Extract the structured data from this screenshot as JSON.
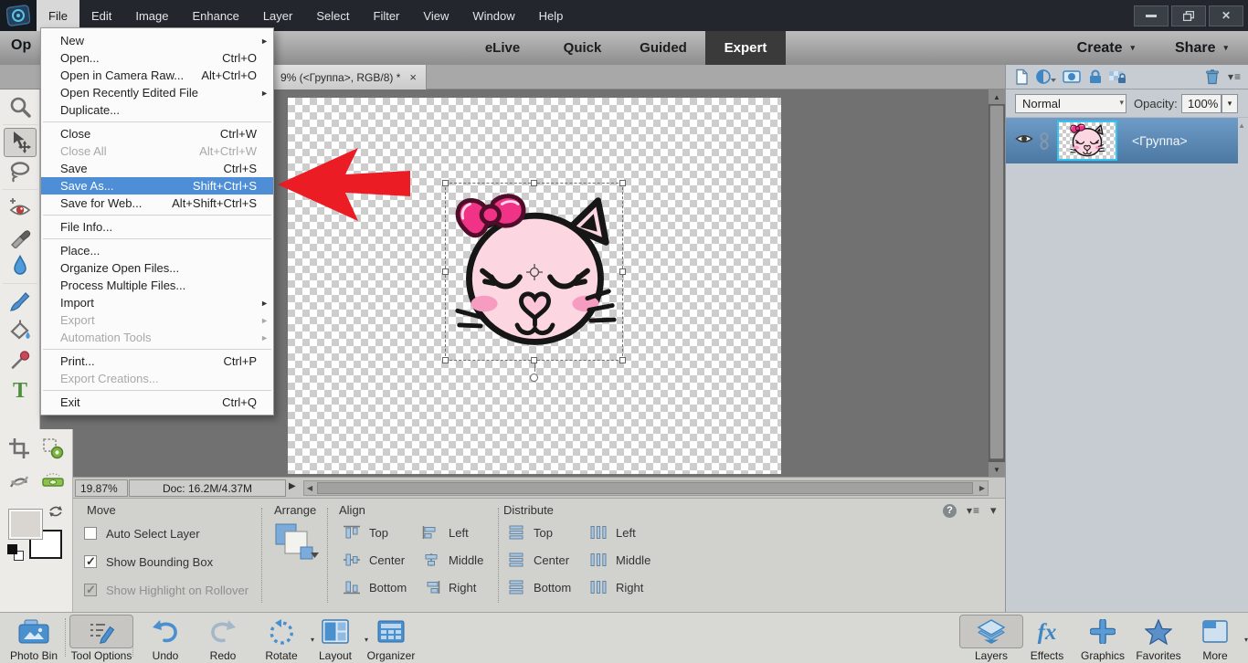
{
  "app": {
    "title_menus": [
      "File",
      "Edit",
      "Image",
      "Enhance",
      "Layer",
      "Select",
      "Filter",
      "View",
      "Window",
      "Help"
    ],
    "active_menu": "File",
    "window_controls": [
      "minimize",
      "restore-down",
      "close"
    ]
  },
  "topbar": {
    "open_button": "Op",
    "mode_tabs": [
      {
        "label": "eLive",
        "active": false
      },
      {
        "label": "Quick",
        "active": false
      },
      {
        "label": "Guided",
        "active": false
      },
      {
        "label": "Expert",
        "active": true
      }
    ],
    "create": {
      "label": "Create"
    },
    "share": {
      "label": "Share"
    }
  },
  "document_tab": {
    "title": "9% (<Группа>, RGB/8) *",
    "close_label": "×"
  },
  "file_menu": {
    "items": [
      {
        "label": "New",
        "submenu": true
      },
      {
        "label": "Open...",
        "shortcut": "Ctrl+O"
      },
      {
        "label": "Open in Camera Raw...",
        "shortcut": "Alt+Ctrl+O"
      },
      {
        "label": "Open Recently Edited File",
        "submenu": true
      },
      {
        "label": "Duplicate...",
        "separator_after": true
      },
      {
        "label": "Close",
        "shortcut": "Ctrl+W"
      },
      {
        "label": "Close All",
        "shortcut": "Alt+Ctrl+W",
        "disabled": true
      },
      {
        "label": "Save",
        "shortcut": "Ctrl+S"
      },
      {
        "label": "Save As...",
        "shortcut": "Shift+Ctrl+S",
        "highlighted": true
      },
      {
        "label": "Save for Web...",
        "shortcut": "Alt+Shift+Ctrl+S",
        "separator_after": true
      },
      {
        "label": "File Info...",
        "separator_after": true
      },
      {
        "label": "Place..."
      },
      {
        "label": "Organize Open Files..."
      },
      {
        "label": "Process Multiple Files..."
      },
      {
        "label": "Import",
        "submenu": true
      },
      {
        "label": "Export",
        "submenu": true,
        "disabled": true
      },
      {
        "label": "Automation Tools",
        "submenu": true,
        "disabled": true,
        "separator_after": true
      },
      {
        "label": "Print...",
        "shortcut": "Ctrl+P"
      },
      {
        "label": "Export Creations...",
        "disabled": true,
        "separator_after": true
      },
      {
        "label": "Exit",
        "shortcut": "Ctrl+Q"
      }
    ]
  },
  "toolbox": {
    "tools": [
      {
        "name": "zoom",
        "selected": false
      },
      {
        "name": "move",
        "selected": true
      },
      {
        "name": "lasso",
        "selected": false
      },
      {
        "name": "red-eye",
        "selected": false
      },
      {
        "name": "spot-healing",
        "selected": false
      },
      {
        "name": "blur",
        "selected": false
      },
      {
        "name": "brush",
        "selected": false
      },
      {
        "name": "paint-bucket",
        "selected": false
      },
      {
        "name": "eyedropper",
        "selected": false
      },
      {
        "name": "type",
        "selected": false
      },
      {
        "name": "crop",
        "selected": false
      },
      {
        "name": "recompose",
        "selected": false
      },
      {
        "name": "content-aware-move",
        "selected": false
      },
      {
        "name": "straighten",
        "selected": false
      }
    ]
  },
  "statusbar": {
    "zoom_level": "19.87%",
    "doc_info": "Doc: 16.2M/4.37M"
  },
  "tool_options": {
    "section_title": "Move",
    "checkboxes": [
      {
        "label": "Auto Select Layer",
        "checked": false,
        "disabled": false
      },
      {
        "label": "Show Bounding Box",
        "checked": true,
        "disabled": false
      },
      {
        "label": "Show Highlight on Rollover",
        "checked": true,
        "disabled": true
      }
    ],
    "arrange_label": "Arrange",
    "align_label": "Align",
    "align_items": [
      "Top",
      "Center",
      "Bottom",
      "Left",
      "Middle",
      "Right"
    ],
    "distribute_label": "Distribute",
    "distribute_items": [
      "Top",
      "Center",
      "Bottom",
      "Left",
      "Middle",
      "Right"
    ]
  },
  "layers_panel": {
    "blend_mode": "Normal",
    "opacity_label": "Opacity:",
    "opacity_value": "100%",
    "layer": {
      "name": "<Группа>"
    }
  },
  "taskbar": {
    "left": [
      {
        "label": "Photo Bin",
        "icon": "photo-bin",
        "active": false,
        "dropdown": false
      },
      {
        "label": "Tool Options",
        "icon": "tool-options",
        "active": true,
        "dropdown": false
      },
      {
        "label": "Undo",
        "icon": "undo",
        "active": false,
        "dropdown": false
      },
      {
        "label": "Redo",
        "icon": "redo",
        "active": false,
        "dropdown": false
      },
      {
        "label": "Rotate",
        "icon": "rotate",
        "active": false,
        "dropdown": true
      },
      {
        "label": "Layout",
        "icon": "layout",
        "active": false,
        "dropdown": true
      },
      {
        "label": "Organizer",
        "icon": "organizer",
        "active": false,
        "dropdown": false
      }
    ],
    "right": [
      {
        "label": "Layers",
        "icon": "layers",
        "active": true,
        "dropdown": false
      },
      {
        "label": "Effects",
        "icon": "effects",
        "active": false,
        "dropdown": false
      },
      {
        "label": "Graphics",
        "icon": "graphics",
        "active": false,
        "dropdown": false
      },
      {
        "label": "Favorites",
        "icon": "favorites",
        "active": false,
        "dropdown": false
      },
      {
        "label": "More",
        "icon": "more",
        "active": false,
        "dropdown": true
      }
    ]
  },
  "colors": {
    "menu_highlight": "#4d8ed6",
    "annotation_arrow_red": "#ec1c24",
    "layer_selected_blue": "#5d89b4",
    "thumbnail_border_cyan": "#35c3ef"
  }
}
